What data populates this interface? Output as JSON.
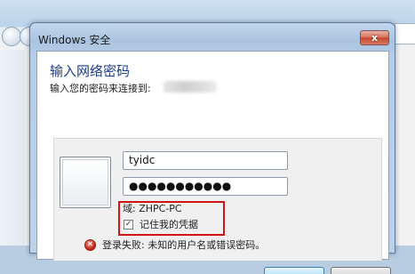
{
  "dialog": {
    "title": "Windows 安全",
    "close_glyph": "x",
    "heading": "输入网络密码",
    "subheading": "输入您的密码来连接到:"
  },
  "credentials": {
    "username_value": "tyidc",
    "password_value": "●●●●●●●●●●●",
    "domain_text": "域: ZHPC-PC",
    "remember_label": "记住我的凭据",
    "remember_checked": true
  },
  "error": {
    "message": "登录失败: 未知的用户名或错误密码。",
    "icon": "error-x-icon"
  },
  "colors": {
    "heading": "#1c3d8c",
    "highlight": "#d01414",
    "close_button": "#c24a30"
  }
}
